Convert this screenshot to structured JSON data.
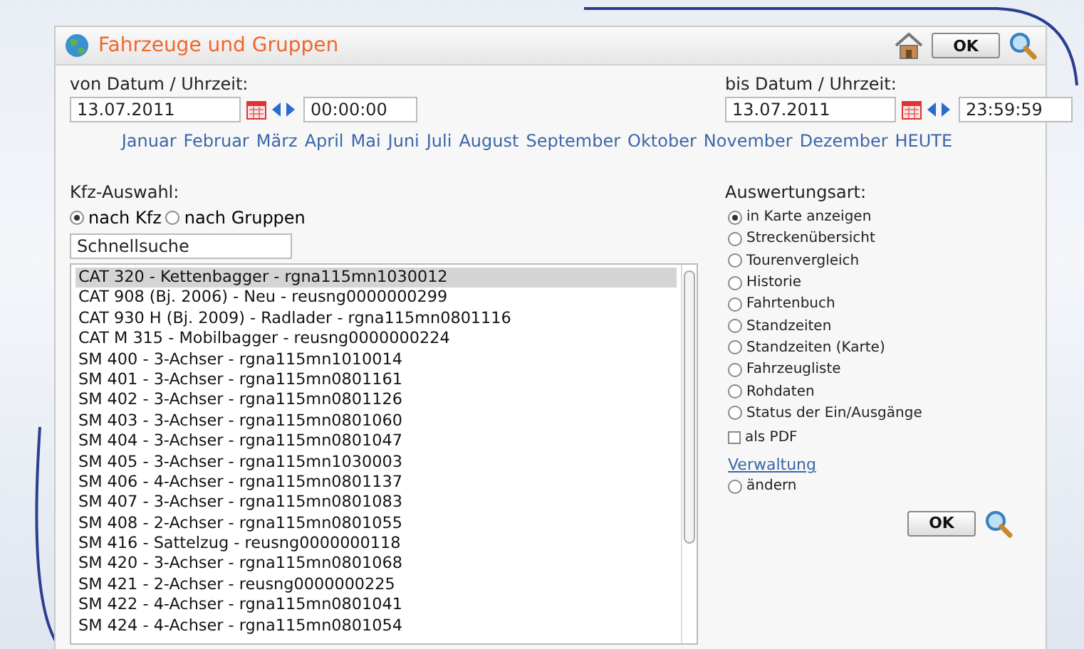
{
  "window": {
    "title": "Fahrzeuge und Gruppen",
    "ok_button": "OK"
  },
  "from": {
    "label": "von Datum / Uhrzeit:",
    "date": "13.07.2011",
    "time": "00:00:00"
  },
  "to": {
    "label": "bis Datum / Uhrzeit:",
    "date": "13.07.2011",
    "time": "23:59:59"
  },
  "months": [
    "Januar",
    "Februar",
    "März",
    "April",
    "Mai",
    "Juni",
    "Juli",
    "August",
    "September",
    "Oktober",
    "November",
    "Dezember",
    "HEUTE"
  ],
  "vehicle_selection": {
    "label": "Kfz-Auswahl:",
    "options": [
      {
        "label": "nach Kfz",
        "selected": true
      },
      {
        "label": "nach Gruppen",
        "selected": false
      }
    ],
    "search": {
      "value": "Schnellsuche"
    },
    "vehicles": [
      {
        "label": "CAT 320 - Kettenbagger - rgna115mn1030012",
        "selected": true
      },
      {
        "label": "CAT 908 (Bj. 2006) - Neu - reusng0000000299",
        "selected": false
      },
      {
        "label": "CAT 930 H (Bj. 2009) - Radlader - rgna115mn0801116",
        "selected": false
      },
      {
        "label": "CAT M 315 - Mobilbagger - reusng0000000224",
        "selected": false
      },
      {
        "label": "SM 400 - 3-Achser - rgna115mn1010014",
        "selected": false
      },
      {
        "label": "SM 401 - 3-Achser - rgna115mn0801161",
        "selected": false
      },
      {
        "label": "SM 402 - 3-Achser - rgna115mn0801126",
        "selected": false
      },
      {
        "label": "SM 403 - 3-Achser - rgna115mn0801060",
        "selected": false
      },
      {
        "label": "SM 404 - 3-Achser - rgna115mn0801047",
        "selected": false
      },
      {
        "label": "SM 405 - 3-Achser - rgna115mn1030003",
        "selected": false
      },
      {
        "label": "SM 406 - 4-Achser - rgna115mn0801137",
        "selected": false
      },
      {
        "label": "SM 407 - 3-Achser - rgna115mn0801083",
        "selected": false
      },
      {
        "label": "SM 408 - 2-Achser - rgna115mn0801055",
        "selected": false
      },
      {
        "label": "SM 416 - Sattelzug - reusng0000000118",
        "selected": false
      },
      {
        "label": "SM 420 - 3-Achser - rgna115mn0801068",
        "selected": false
      },
      {
        "label": "SM 421 - 2-Achser - reusng0000000225",
        "selected": false
      },
      {
        "label": "SM 422 - 4-Achser - rgna115mn0801041",
        "selected": false
      },
      {
        "label": "SM 424 - 4-Achser - rgna115mn0801054",
        "selected": false
      }
    ]
  },
  "evaluation": {
    "label": "Auswertungsart:",
    "options": [
      {
        "label": "in Karte anzeigen",
        "selected": true
      },
      {
        "label": "Streckenübersicht",
        "selected": false
      },
      {
        "label": "Tourenvergleich",
        "selected": false
      },
      {
        "label": "Historie",
        "selected": false
      },
      {
        "label": "Fahrtenbuch",
        "selected": false
      },
      {
        "label": "Standzeiten",
        "selected": false
      },
      {
        "label": "Standzeiten (Karte)",
        "selected": false
      },
      {
        "label": "Fahrzeugliste",
        "selected": false
      },
      {
        "label": "Rohdaten",
        "selected": false
      },
      {
        "label": "Status der Ein/Ausgänge",
        "selected": false
      }
    ],
    "pdf": {
      "label": "als PDF",
      "checked": false
    },
    "admin_link": "Verwaltung",
    "admin_options": [
      {
        "label": "ändern",
        "selected": false
      }
    ],
    "ok_button": "OK"
  }
}
